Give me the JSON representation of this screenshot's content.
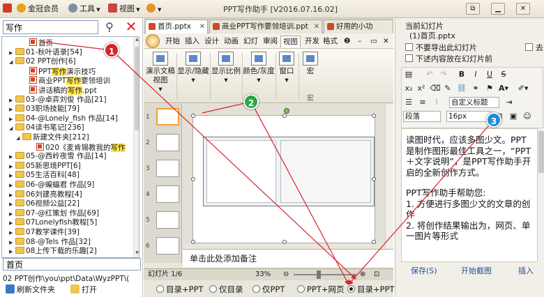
{
  "titlebar": {
    "menu": [
      {
        "label": "金冠会员",
        "icon": "crown-icon"
      },
      {
        "label": "工具",
        "icon": "gear-icon"
      },
      {
        "label": "视图",
        "icon": "view-icon"
      }
    ],
    "skin_icon": "skin-icon",
    "title": "PPT写作助手 [V2016.07.16.02]"
  },
  "left": {
    "search_value": "写作",
    "tree": [
      {
        "text": "首页",
        "type": "ppt",
        "indent": 3,
        "highlight": ""
      },
      {
        "text": "01-秋叶语录[54]",
        "type": "folder",
        "indent": 1,
        "expand": "▶",
        "highlight": ""
      },
      {
        "text": "02 PPT创作[6]",
        "type": "folder",
        "indent": 1,
        "expand": "◢",
        "highlight": ""
      },
      {
        "pre": "PPT",
        "hl": "写作",
        "post": "演示技巧",
        "type": "ppt",
        "indent": 3
      },
      {
        "pre": "商业PPT",
        "hl": "写作",
        "post": "要领培训",
        "type": "ppt",
        "indent": 3
      },
      {
        "pre": "讲话稿的",
        "hl": "写作",
        "post": ".ppt",
        "type": "ppt",
        "indent": 3
      },
      {
        "text": "03-@卓弈刘俊 作品[21]",
        "type": "folder",
        "indent": 1,
        "expand": "▶",
        "highlight": ""
      },
      {
        "text": "03职场技能[79]",
        "type": "folder",
        "indent": 1,
        "expand": "▶",
        "highlight": ""
      },
      {
        "text": "04-@Lonely_fish 作品[14]",
        "type": "folder",
        "indent": 1,
        "expand": "▶",
        "highlight": ""
      },
      {
        "text": "04读书笔记[236]",
        "type": "folder",
        "indent": 1,
        "expand": "◢",
        "highlight": ""
      },
      {
        "text": "新建文件夹[212]",
        "type": "folder",
        "indent": 2,
        "expand": "◢",
        "highlight": ""
      },
      {
        "pre": "020《麦肯锡教我的",
        "hl": "写作",
        "post": "",
        "type": "ppt",
        "indent": 4
      },
      {
        "text": "05-@西岭夜雪 作品[14]",
        "type": "folder",
        "indent": 1,
        "expand": "▶",
        "highlight": ""
      },
      {
        "text": "05新思境PPT[6]",
        "type": "folder",
        "indent": 1,
        "expand": "▶",
        "highlight": ""
      },
      {
        "text": "05生活百科[48]",
        "type": "folder",
        "indent": 1,
        "expand": "▶",
        "highlight": ""
      },
      {
        "text": "06-@蝙蝠君 作品[9]",
        "type": "folder",
        "indent": 1,
        "expand": "▶",
        "highlight": ""
      },
      {
        "text": "06刘建亮教程[4]",
        "type": "folder",
        "indent": 1,
        "expand": "▶",
        "highlight": ""
      },
      {
        "text": "06视频公益[22]",
        "type": "folder",
        "indent": 1,
        "expand": "▶",
        "highlight": ""
      },
      {
        "text": "07-@红策划 作品[69]",
        "type": "folder",
        "indent": 1,
        "expand": "▶",
        "highlight": ""
      },
      {
        "text": "07Lonelyfish教程[5]",
        "type": "folder",
        "indent": 1,
        "expand": "▶",
        "highlight": ""
      },
      {
        "text": "07教学课件[39]",
        "type": "folder",
        "indent": 1,
        "expand": "▶",
        "highlight": ""
      },
      {
        "text": "08-@Tels 作品[32]",
        "type": "folder",
        "indent": 1,
        "expand": "▶",
        "highlight": ""
      },
      {
        "text": "08上传下载的乐趣[2]",
        "type": "folder",
        "indent": 1,
        "expand": "▶",
        "highlight": ""
      }
    ],
    "name_value": "首页",
    "path": "02 PPT创作\\you\\ppt\\Data\\WyzPPT\\(",
    "refresh_label": "刷新文件夹",
    "open_label": "打开"
  },
  "middle": {
    "doc_tabs": [
      {
        "label": "首页.pptx",
        "active": true
      },
      {
        "label": "商业PPT写作要领培训.ppt",
        "active": false
      },
      {
        "label": "好用的小功",
        "active": false
      }
    ],
    "ribbon_tabs": [
      "开始",
      "插入",
      "设计",
      "动画",
      "幻灯",
      "审阅",
      "视图",
      "开发",
      "格式"
    ],
    "active_ribbon_tab": "视图",
    "ribbon_groups": [
      {
        "label": "演示文稿视图"
      },
      {
        "label": "显示/隐藏"
      },
      {
        "label": "显示比例"
      },
      {
        "label": "颜色/灰度"
      },
      {
        "label": "窗口"
      },
      {
        "label": "宏"
      }
    ],
    "group_caption": "宏",
    "thumb_numbers": [
      "1",
      "2",
      "3",
      "4",
      "5",
      "6"
    ],
    "notes_placeholder": "单击此处添加备注",
    "status_slide": "幻灯片 1/6",
    "zoom": "33%",
    "export_modes": [
      {
        "label": "目录+PPT",
        "checked": false
      },
      {
        "label": "仅目录",
        "checked": false
      },
      {
        "label": "仅PPT",
        "checked": false
      },
      {
        "label": "PPT+网页",
        "checked": false
      },
      {
        "label": "目录+PPT+网页",
        "checked": true
      }
    ]
  },
  "right": {
    "current_slide_label": "当前幻灯片",
    "current_slide_value": "(1)首页.pptx",
    "checkboxes": [
      {
        "label": "不要导出此幻灯片",
        "checked": false
      },
      {
        "label": "去",
        "checked": false
      },
      {
        "label": "下述内容放在幻灯片前",
        "checked": false
      }
    ],
    "format_select": "段落",
    "size_select": "16px",
    "style_select": "自定义标题",
    "paragraphs": [
      "读图时代，应该多图少文。PPT是制作图形最佳工具之一，“PPT＋文字说明”，是PPT写作助手开启的全新创作方式。",
      "PPT写作助手帮助您:",
      "1. 方便进行多图少文的文章的创作",
      "2. 将创作结果输出为，网页、单一图片等形式"
    ],
    "save_label": "保存(S)",
    "open_image_label": "开始截图",
    "insert_image_label": "插入"
  },
  "callouts": [
    {
      "label": "1",
      "color": "#d8232a"
    },
    {
      "label": "2",
      "color": "#2aa843"
    },
    {
      "label": "3",
      "color": "#1b8fd6"
    }
  ]
}
